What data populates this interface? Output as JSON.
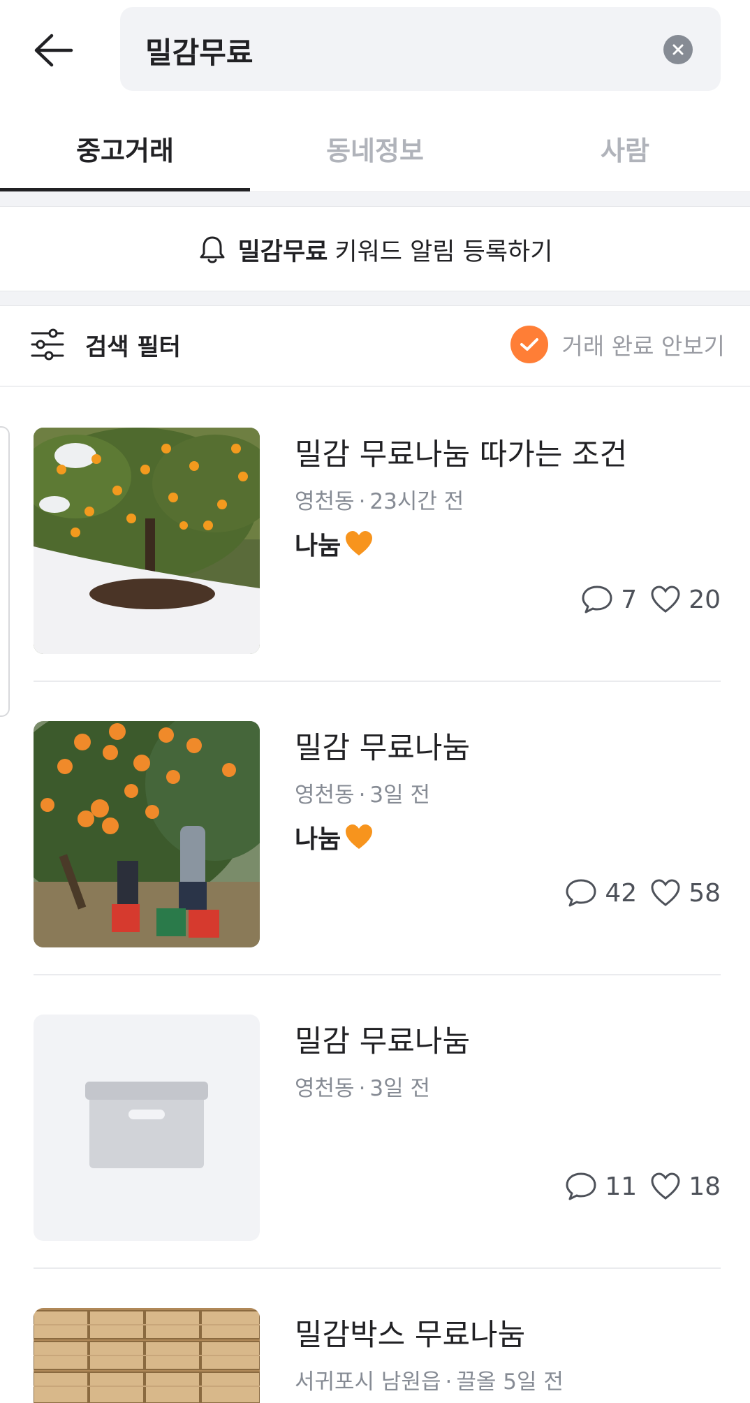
{
  "search": {
    "value": "밀감무료"
  },
  "tabs": [
    {
      "label": "중고거래",
      "active": true
    },
    {
      "label": "동네정보",
      "active": false
    },
    {
      "label": "사람",
      "active": false
    }
  ],
  "alert": {
    "keyword": "밀감무료",
    "text": "키워드 알림 등록하기"
  },
  "filter": {
    "label": "검색 필터",
    "hide_completed_label": "거래 완료 안보기",
    "hide_completed_checked": true
  },
  "colors": {
    "accent": "#ff7e36",
    "text": "#212124",
    "muted": "#868b94"
  },
  "items": [
    {
      "title": "밀감 무료나눔 따가는 조건",
      "location": "영천동",
      "time": "23시간 전",
      "price": "나눔",
      "comments": "7",
      "likes": "20",
      "thumb": "snowy-tangerine-tree"
    },
    {
      "title": "밀감 무료나눔",
      "location": "영천동",
      "time": "3일 전",
      "price": "나눔",
      "comments": "42",
      "likes": "58",
      "thumb": "tangerine-harvest"
    },
    {
      "title": "밀감 무료나눔",
      "location": "영천동",
      "time": "3일 전",
      "price": "",
      "comments": "11",
      "likes": "18",
      "thumb": "placeholder-box-icon"
    },
    {
      "title": "밀감박스 무료나눔",
      "location": "서귀포시 남원읍",
      "time": "끌올 5일 전",
      "price": "",
      "comments": "",
      "likes": "",
      "thumb": "wooden-crates"
    }
  ]
}
